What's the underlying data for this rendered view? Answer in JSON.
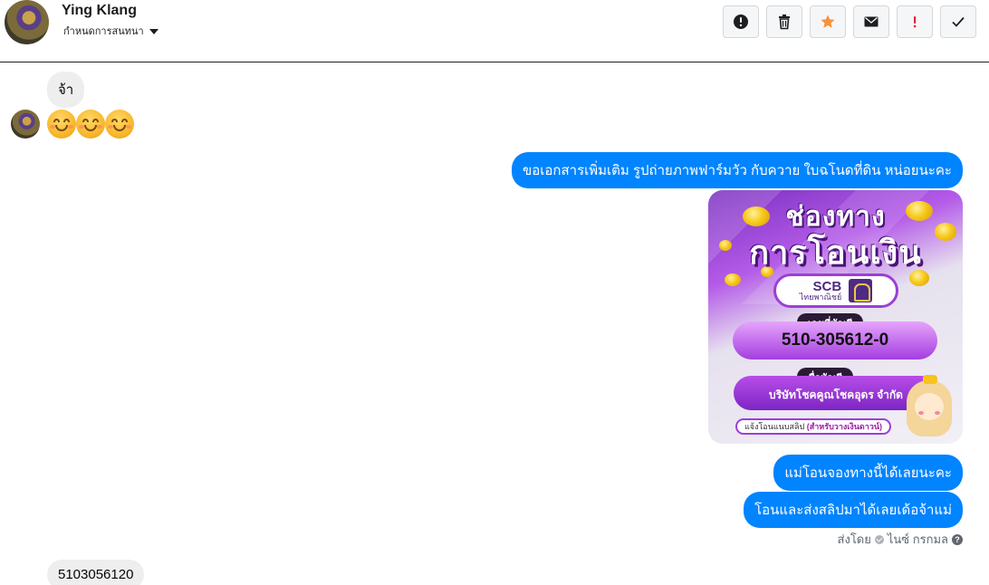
{
  "header": {
    "contact_name": "Ying Klang",
    "conversation_settings": "กำหนดการสนทนา",
    "actions": [
      {
        "name": "mark-spam-button",
        "icon": "alert-circle-icon"
      },
      {
        "name": "delete-button",
        "icon": "trash-icon"
      },
      {
        "name": "star-button",
        "icon": "star-icon",
        "color": "#f7923b"
      },
      {
        "name": "mark-unread-button",
        "icon": "envelope-icon"
      },
      {
        "name": "priority-button",
        "icon": "exclamation-icon",
        "color": "#e41e3f"
      },
      {
        "name": "mark-done-button",
        "icon": "checkmark-icon"
      }
    ]
  },
  "messages": {
    "incoming_1": "จ้า",
    "incoming_emojis": [
      "smiling-face-emoji",
      "smiling-face-emoji",
      "smiling-face-emoji"
    ],
    "outgoing_1": "ขอเอกสารเพิ่มเติม  รูปถ่ายภาพฟาร์มวัว กับควาย ใบฉโนดที่ดิน หน่อยนะคะ",
    "promo_image": {
      "title_line1": "ช่องทาง",
      "title_line2": "การโอนเงิน",
      "bank_name": "SCB",
      "bank_name_thai": "ไทยพาณิชย์",
      "account_number_label": "เลขที่บัญชี",
      "account_number": "510-305612-0",
      "account_name_label": "ชื่อบัญชี",
      "account_name": "บริษัทโชคคูณโชคอุดร จำกัด",
      "slip_note_prefix": "แจ้งโอนแนบสลิป",
      "slip_note_paren": "(สำหรับวางเงินดาวน์)"
    },
    "outgoing_2": "แม่โอนจองทางนี้ได้เลยนะคะ",
    "outgoing_3": "โอนและส่งสลิปมาได้เลยเด้อจ้าแม่",
    "seen_by_label": "ส่งโดย",
    "seen_by_name": "ไนซ์ กรกมล",
    "incoming_2": "5103056120"
  },
  "colors": {
    "outgoing_bubble": "#0084ff",
    "incoming_bubble": "#eeeeee"
  }
}
